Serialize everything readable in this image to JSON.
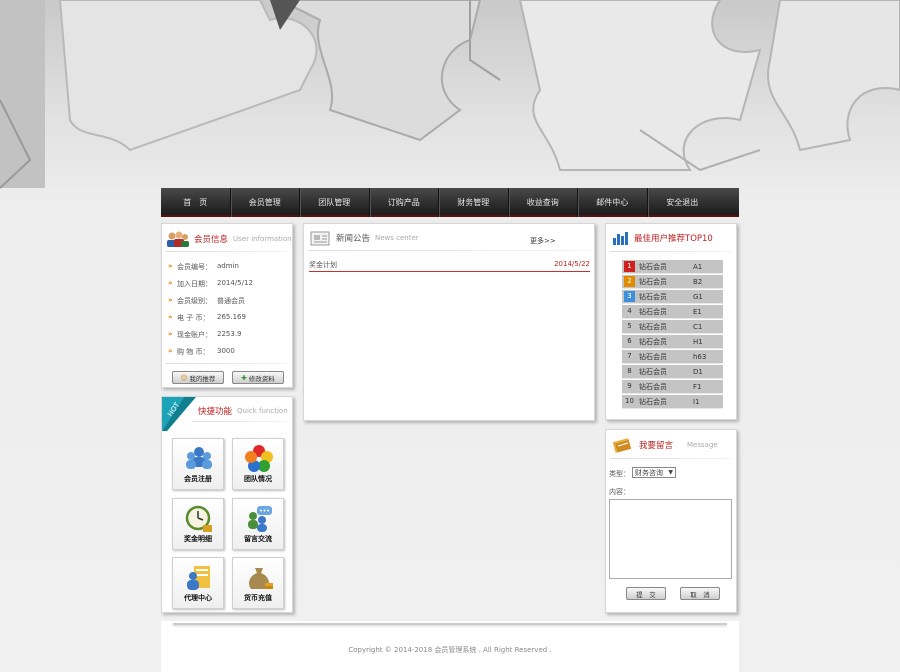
{
  "nav": {
    "items": [
      "首　页",
      "会员管理",
      "团队管理",
      "订购产品",
      "财务管理",
      "收益查询",
      "邮件中心",
      "安全退出"
    ]
  },
  "member_info": {
    "title_zh": "会员信息",
    "title_en": "User information",
    "rows": [
      {
        "label": "会员编号：",
        "value": "admin"
      },
      {
        "label": "加入日期：",
        "value": "2014/5/12"
      },
      {
        "label": "会员级别：",
        "value": "普通会员"
      },
      {
        "label": "电 子 币：",
        "value": "265.169"
      },
      {
        "label": "现金账户：",
        "value": "2253.9"
      },
      {
        "label": "购 物 币：",
        "value": "3000"
      }
    ],
    "btn_left": "我的推荐",
    "btn_right": "修改资料"
  },
  "quick": {
    "title_zh": "快捷功能",
    "title_en": "Quick function",
    "hot_badge": "HOT",
    "items": [
      "会员注册",
      "团队情况",
      "奖金明细",
      "留言交流",
      "代理中心",
      "货币充值"
    ]
  },
  "news": {
    "title_zh": "新闻公告",
    "title_en": "News center",
    "more": "更多>>",
    "items": [
      {
        "title": "奖金计划",
        "date": "2014/5/22"
      }
    ]
  },
  "top10": {
    "title": "最佳用户推荐TOP10",
    "rows": [
      {
        "rank": "1",
        "level": "钻石会员",
        "user": "A1"
      },
      {
        "rank": "2",
        "level": "钻石会员",
        "user": "B2"
      },
      {
        "rank": "3",
        "level": "钻石会员",
        "user": "G1"
      },
      {
        "rank": "4",
        "level": "钻石会员",
        "user": "E1"
      },
      {
        "rank": "5",
        "level": "钻石会员",
        "user": "C1"
      },
      {
        "rank": "6",
        "level": "钻石会员",
        "user": "H1"
      },
      {
        "rank": "7",
        "level": "钻石会员",
        "user": "h63"
      },
      {
        "rank": "8",
        "level": "钻石会员",
        "user": "D1"
      },
      {
        "rank": "9",
        "level": "钻石会员",
        "user": "F1"
      },
      {
        "rank": "10",
        "level": "钻石会员",
        "user": "I1"
      }
    ],
    "rank_colors": [
      "#d02020",
      "#e08a00",
      "#3c8fd8"
    ]
  },
  "message": {
    "title_zh": "我要留言",
    "title_en": "Message",
    "type_label": "类型：",
    "type_value": "财务咨询",
    "content_label": "内容：",
    "submit": "提　交",
    "cancel": "取　消"
  },
  "footer": {
    "copyright": "Copyright © 2014-2018 会员管理系统 . All Right Reserved ."
  }
}
